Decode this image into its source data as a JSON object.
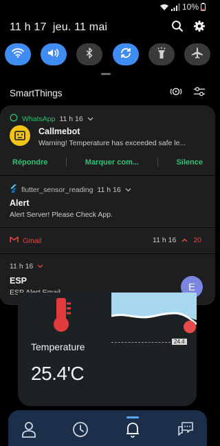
{
  "status_bar": {
    "battery": "10%"
  },
  "quick_settings": {
    "time": "11 h 17",
    "date": "jeu. 11 mai",
    "toggles": [
      {
        "name": "wifi",
        "state": "on"
      },
      {
        "name": "sound",
        "state": "on"
      },
      {
        "name": "bluetooth",
        "state": "off"
      },
      {
        "name": "auto-rotate",
        "state": "on"
      },
      {
        "name": "flashlight",
        "state": "off"
      },
      {
        "name": "airplane-mode",
        "state": "off"
      }
    ]
  },
  "smartthings": {
    "title": "SmartThings"
  },
  "notifications": {
    "whatsapp": {
      "app": "WhatsApp",
      "time": "11 h 16",
      "sender": "Callmebot",
      "message": "Warning! Temperature has exceeded safe le...",
      "actions": [
        "Répondre",
        "Marquer com...",
        "Silence"
      ]
    },
    "flutter": {
      "app": "flutter_sensor_reading",
      "time": "11 h 16",
      "title": "Alert",
      "message": "Alert Server! Please Check App."
    },
    "gmail": {
      "app": "Gmail",
      "time": "11 h 16",
      "count": "20"
    },
    "esp": {
      "time": "11 h 16",
      "title": "ESP",
      "message": "ESP Alert Email",
      "avatar_letter": "E"
    }
  },
  "app": {
    "label": "Temperature",
    "value": "25.4'C",
    "chart_tag": "24.4"
  },
  "colors": {
    "toggle_on": "#3f8cf2",
    "whatsapp_green": "#27c36e",
    "gmail_red": "#e8493f",
    "avatar_purple": "#7a86e0",
    "nav_bg": "#1c2f4a"
  }
}
